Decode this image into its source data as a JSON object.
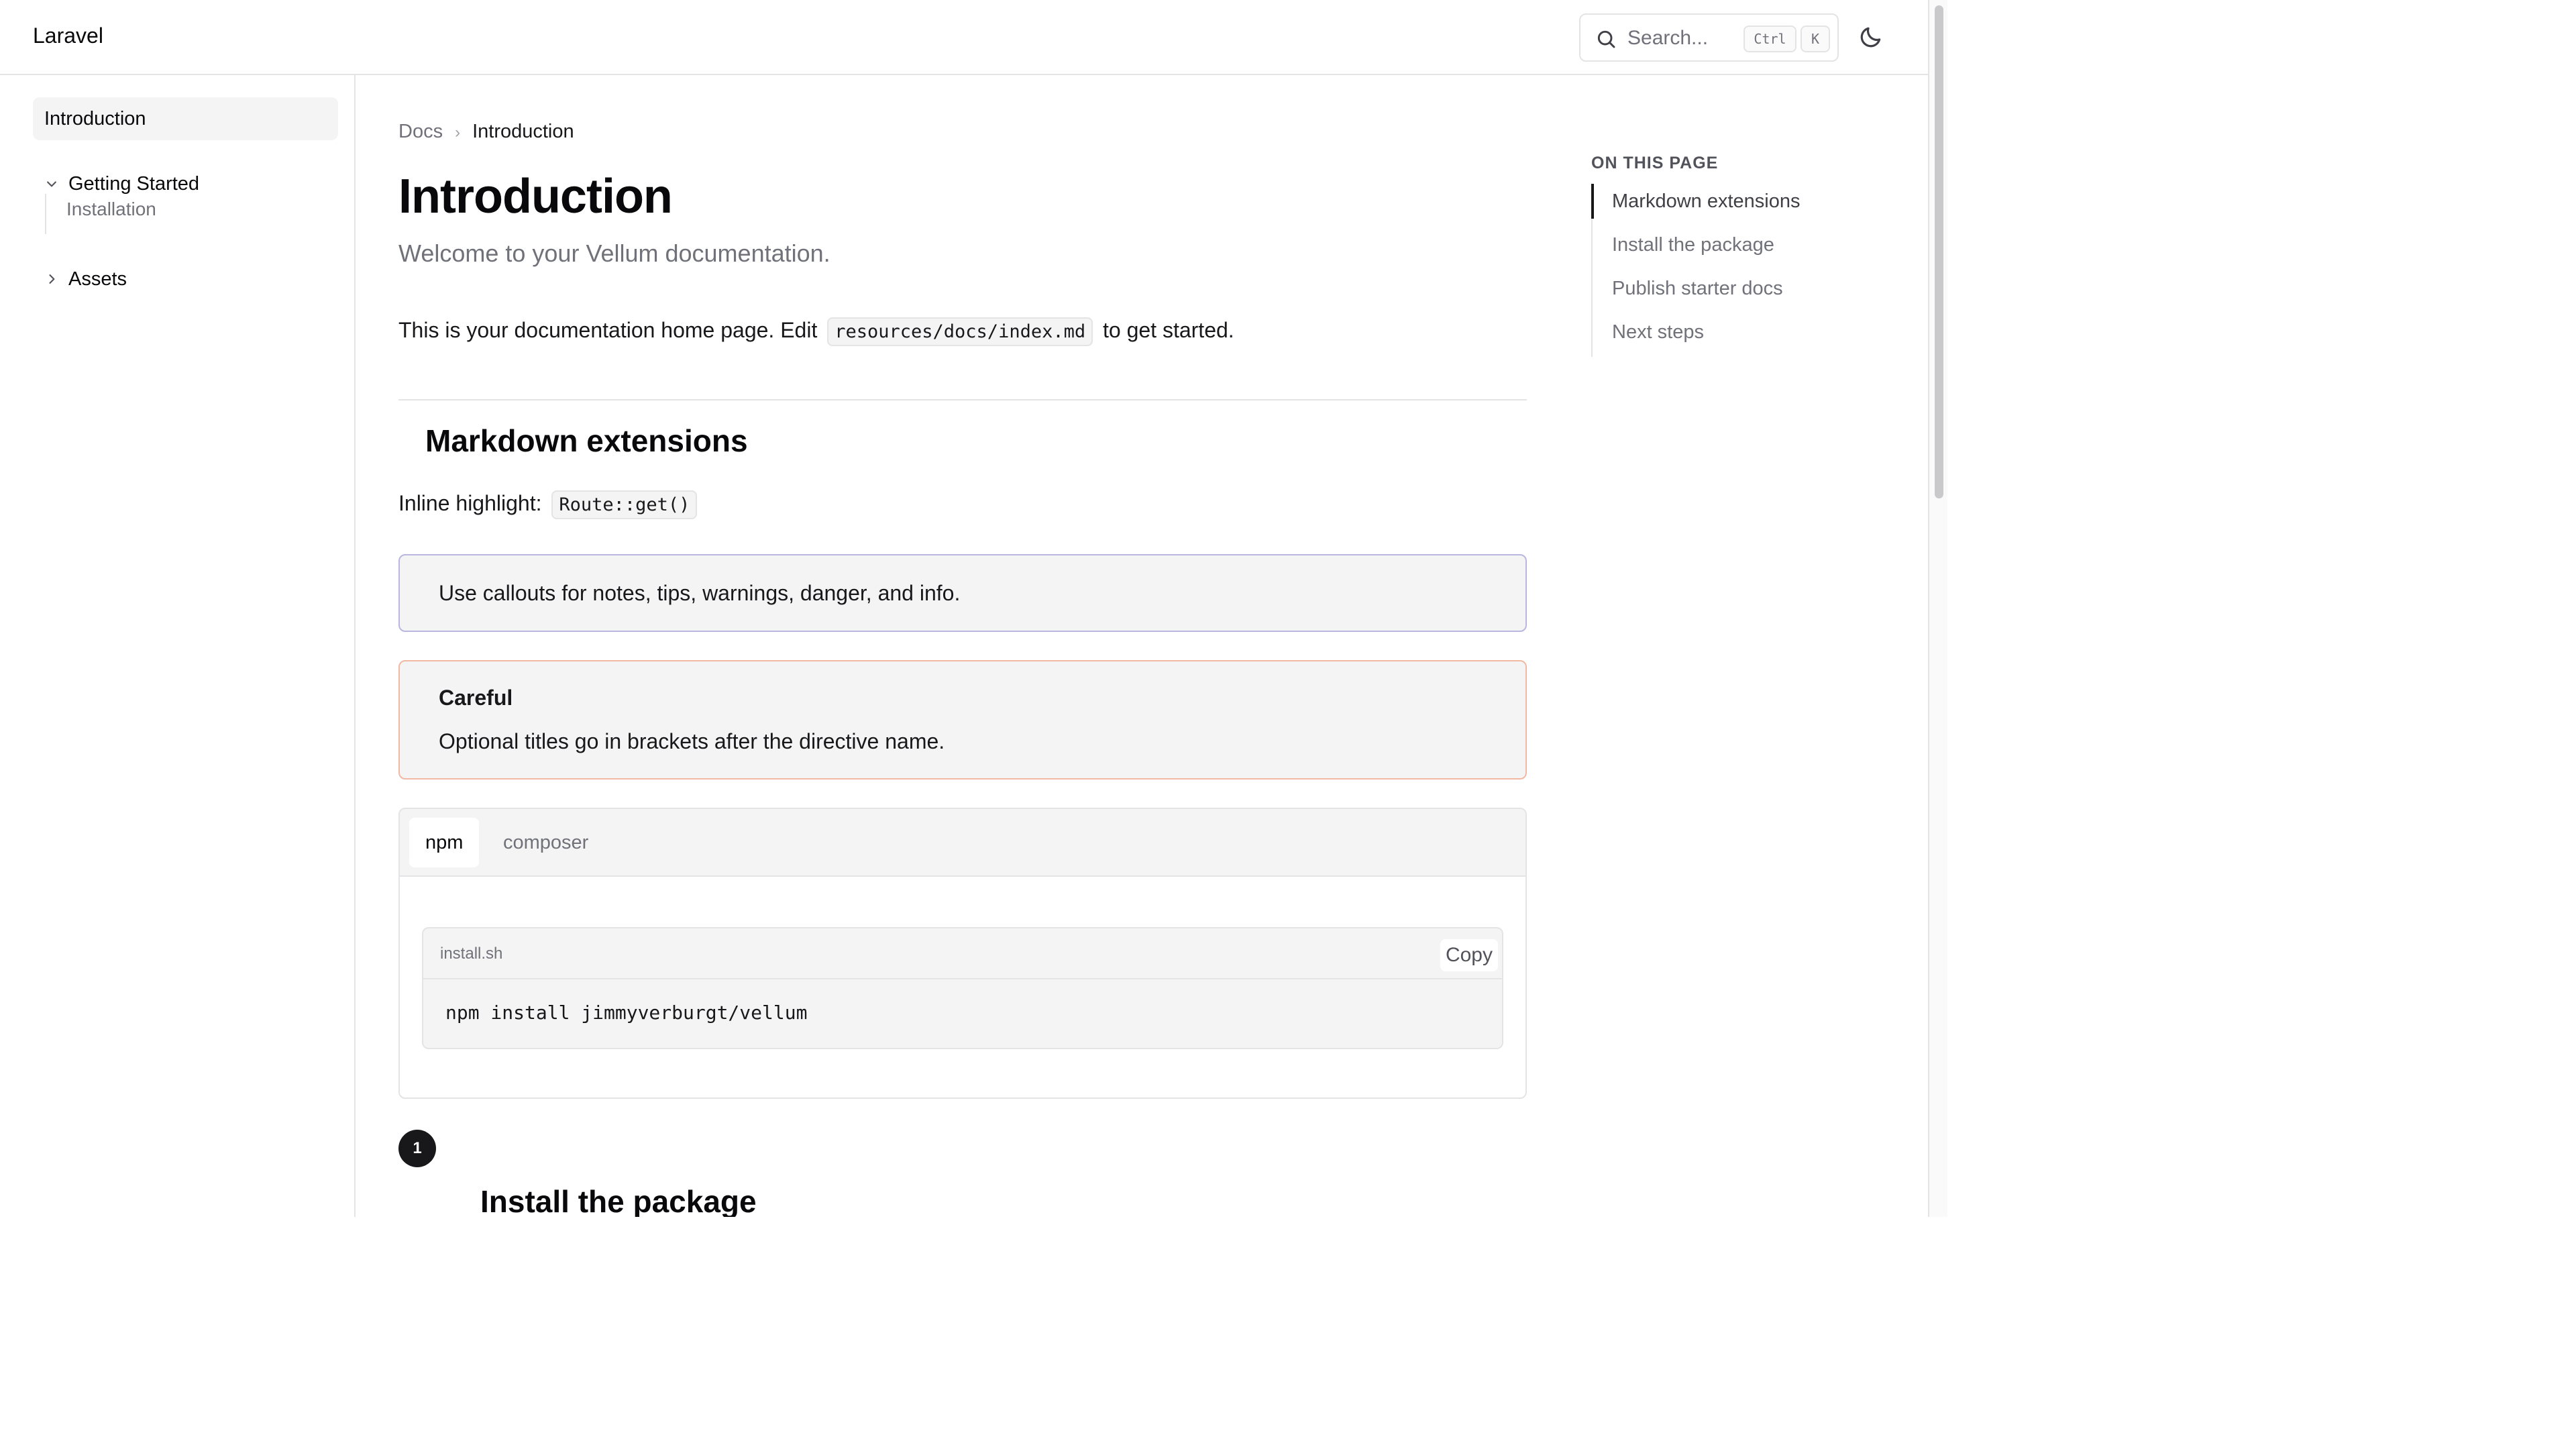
{
  "header": {
    "brand": "Laravel",
    "search_placeholder": "Search...",
    "shortcut_ctrl": "Ctrl",
    "shortcut_key": "K"
  },
  "sidebar": {
    "items": [
      {
        "label": "Introduction",
        "active": true
      },
      {
        "label": "Getting Started",
        "expanded": true,
        "children": [
          {
            "label": "Installation"
          }
        ]
      },
      {
        "label": "Assets",
        "expanded": false
      }
    ]
  },
  "breadcrumb": {
    "root": "Docs",
    "current": "Introduction"
  },
  "content": {
    "title": "Introduction",
    "lead": "Welcome to your Vellum documentation.",
    "intro_before": "This is your documentation home page. Edit",
    "intro_code": "resources/docs/index.md",
    "intro_after": "to get started.",
    "section_markdown": "Markdown extensions",
    "inline_highlight_label": "Inline highlight:",
    "inline_highlight_code": "Route::get()",
    "callout_note": "Use callouts for notes, tips, warnings, danger, and info.",
    "callout_warning_title": "Careful",
    "callout_warning_text": "Optional titles go in brackets after the directive name.",
    "tabs": [
      "npm",
      "composer"
    ],
    "code_filename": "install.sh",
    "copy_label": "Copy",
    "code": "npm install jimmyverburgt/vellum",
    "step_number": "1",
    "step_title": "Install the package"
  },
  "toc": {
    "title": "ON THIS PAGE",
    "items": [
      {
        "label": "Markdown extensions",
        "active": true
      },
      {
        "label": "Install the package"
      },
      {
        "label": "Publish starter docs"
      },
      {
        "label": "Next steps"
      }
    ]
  },
  "colors": {
    "text": "#09090b",
    "muted": "#71717a",
    "border": "#e4e4e7",
    "note_border": "#b9b6e0",
    "warning_border": "#f2b9a2",
    "surface": "#f4f4f5"
  },
  "icons": [
    "search-icon",
    "moon-icon",
    "chevron-down-icon",
    "chevron-right-icon"
  ]
}
